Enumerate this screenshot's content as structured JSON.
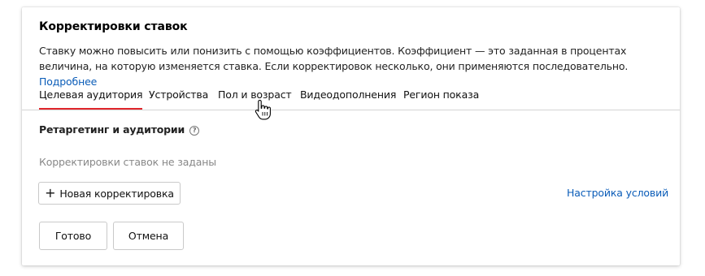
{
  "panel": {
    "title": "Корректировки ставок",
    "description": "Ставку можно повысить или понизить с помощью коэффициентов. Коэффициент — это заданная в процентах величина, на которую изменяется ставка. Если корректировок несколько, они применяются последовательно.",
    "more_link": "Подробнее"
  },
  "tabs": [
    {
      "label": "Целевая аудитория",
      "active": true
    },
    {
      "label": "Устройства",
      "active": false
    },
    {
      "label": "Пол и возраст",
      "active": false
    },
    {
      "label": "Видеодополнения",
      "active": false
    },
    {
      "label": "Регион показа",
      "active": false
    }
  ],
  "section": {
    "title": "Ретаргетинг и аудитории",
    "help_icon": "question-circle-icon",
    "empty_text": "Корректировки ставок не заданы"
  },
  "actions": {
    "new_adjustment_label": "Новая корректировка",
    "settings_link": "Настройка условий",
    "done_label": "Готово",
    "cancel_label": "Отмена"
  },
  "colors": {
    "accent_tab": "#e0262b",
    "link": "#0a5cb8",
    "muted_text": "#888888"
  }
}
